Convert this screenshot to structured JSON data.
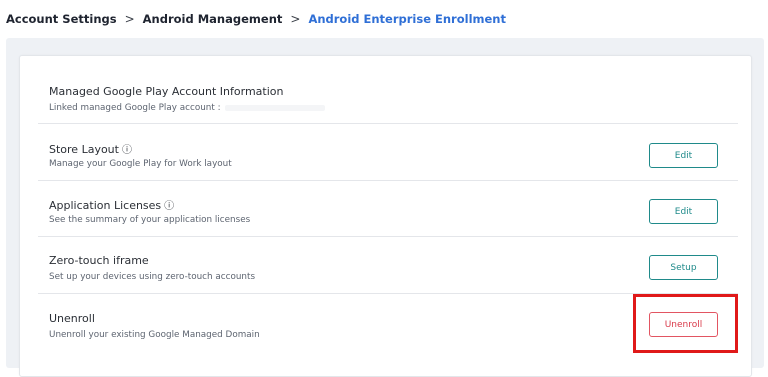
{
  "breadcrumb": {
    "items": [
      "Account Settings",
      "Android Management",
      "Android Enterprise Enrollment"
    ],
    "separator": ">"
  },
  "sections": [
    {
      "title": "Managed Google Play Account Information",
      "description": "Linked managed Google Play account :",
      "info_icon": false,
      "button": null
    },
    {
      "title": "Store Layout",
      "description": "Manage your Google Play for Work layout",
      "info_icon": true,
      "button": "Edit"
    },
    {
      "title": "Application Licenses",
      "description": "See the summary of your application licenses",
      "info_icon": true,
      "button": "Edit"
    },
    {
      "title": "Zero-touch iframe",
      "description": "Set up your devices using zero-touch accounts",
      "info_icon": false,
      "button": "Setup"
    },
    {
      "title": "Unenroll",
      "description": "Unenroll your existing Google Managed Domain",
      "info_icon": false,
      "button": "Unenroll"
    }
  ],
  "icons": {
    "info": "info-circle-icon",
    "chevron": "chevron-right-icon"
  },
  "colors": {
    "breadcrumb_current": "#2f6fd6",
    "button_border": "#1f8a8a",
    "danger": "#d93a4a",
    "highlight": "#e01919"
  }
}
